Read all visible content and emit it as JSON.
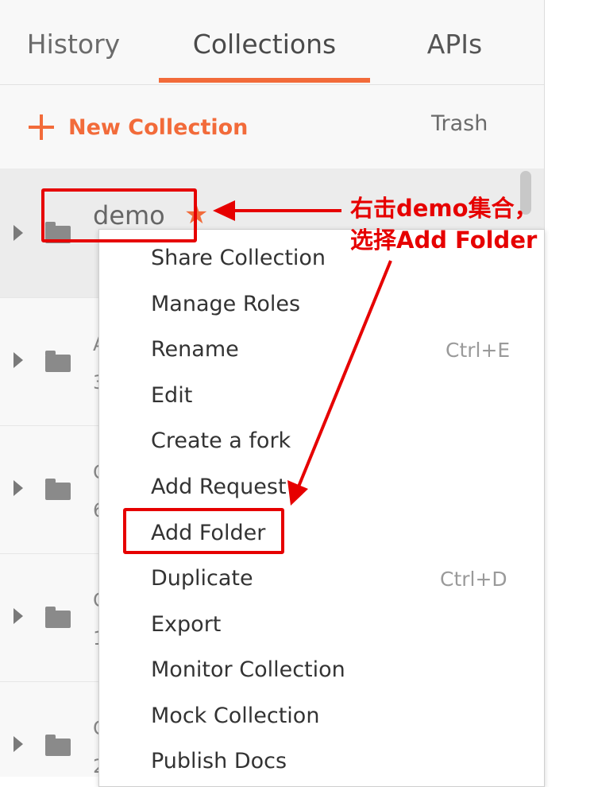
{
  "tabs": [
    {
      "label": "History",
      "active": false
    },
    {
      "label": "Collections",
      "active": true
    },
    {
      "label": "APIs",
      "active": false
    }
  ],
  "toolbar": {
    "new_collection": "New Collection",
    "trash": "Trash"
  },
  "collections": [
    {
      "name": "demo",
      "selected": true
    },
    {
      "name_fragment": "A",
      "count_fragment": "3"
    },
    {
      "name_fragment": "C",
      "count_fragment": "6"
    },
    {
      "name_fragment": "C",
      "count_fragment": "1"
    },
    {
      "name_fragment": "C",
      "count_fragment": "2"
    }
  ],
  "context_menu": {
    "items": [
      {
        "label": "Share Collection",
        "shortcut": ""
      },
      {
        "label": "Manage Roles",
        "shortcut": ""
      },
      {
        "label": "Rename",
        "shortcut": "Ctrl+E"
      },
      {
        "label": "Edit",
        "shortcut": ""
      },
      {
        "label": "Create a fork",
        "shortcut": ""
      },
      {
        "label": "Add Request",
        "shortcut": ""
      },
      {
        "label": "Add Folder",
        "shortcut": "",
        "highlighted": true
      },
      {
        "label": "Duplicate",
        "shortcut": "Ctrl+D"
      },
      {
        "label": "Export",
        "shortcut": ""
      },
      {
        "label": "Monitor Collection",
        "shortcut": ""
      },
      {
        "label": "Mock Collection",
        "shortcut": ""
      },
      {
        "label": "Publish Docs",
        "shortcut": ""
      }
    ]
  },
  "annotation": {
    "line1": "右击demo集合，",
    "line2": "选择Add Folder"
  },
  "colors": {
    "accent": "#f26b3a",
    "annotation": "#e60000"
  },
  "icons": [
    "plus-icon",
    "caret-right-icon",
    "folder-icon",
    "star-icon"
  ]
}
